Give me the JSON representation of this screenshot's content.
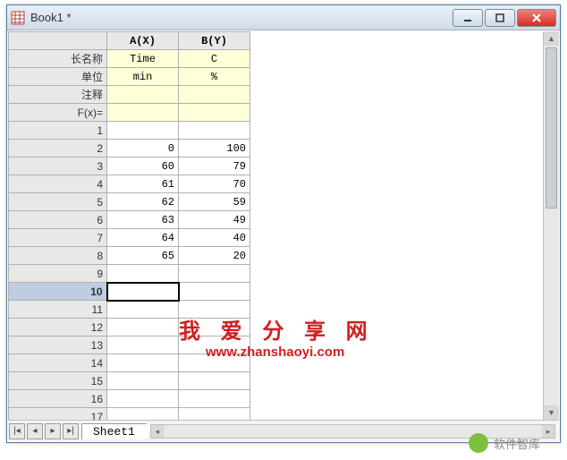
{
  "window": {
    "title": "Book1 *"
  },
  "columns": {
    "a": "A(X)",
    "b": "B(Y)"
  },
  "meta": {
    "longname_label": "长名称",
    "units_label": "单位",
    "comments_label": "注释",
    "fx_label": "F(x)=",
    "a_longname": "Time",
    "b_longname": "C",
    "a_units": "min",
    "b_units": "%",
    "a_comments": "",
    "b_comments": "",
    "a_fx": "",
    "b_fx": ""
  },
  "rows": [
    {
      "n": "1",
      "a": "",
      "b": ""
    },
    {
      "n": "2",
      "a": "0",
      "b": "100"
    },
    {
      "n": "3",
      "a": "60",
      "b": "79"
    },
    {
      "n": "4",
      "a": "61",
      "b": "70"
    },
    {
      "n": "5",
      "a": "62",
      "b": "59"
    },
    {
      "n": "6",
      "a": "63",
      "b": "49"
    },
    {
      "n": "7",
      "a": "64",
      "b": "40"
    },
    {
      "n": "8",
      "a": "65",
      "b": "20"
    },
    {
      "n": "9",
      "a": "",
      "b": ""
    },
    {
      "n": "10",
      "a": "",
      "b": ""
    },
    {
      "n": "11",
      "a": "",
      "b": ""
    },
    {
      "n": "12",
      "a": "",
      "b": ""
    },
    {
      "n": "13",
      "a": "",
      "b": ""
    },
    {
      "n": "14",
      "a": "",
      "b": ""
    },
    {
      "n": "15",
      "a": "",
      "b": ""
    },
    {
      "n": "16",
      "a": "",
      "b": ""
    },
    {
      "n": "17",
      "a": "",
      "b": ""
    }
  ],
  "selected_row": 10,
  "sheet_tab": "Sheet1",
  "watermark": {
    "line1": "我 爱 分 享 网",
    "line2": "www.zhanshaoyi.com"
  },
  "brand": "软件智库"
}
